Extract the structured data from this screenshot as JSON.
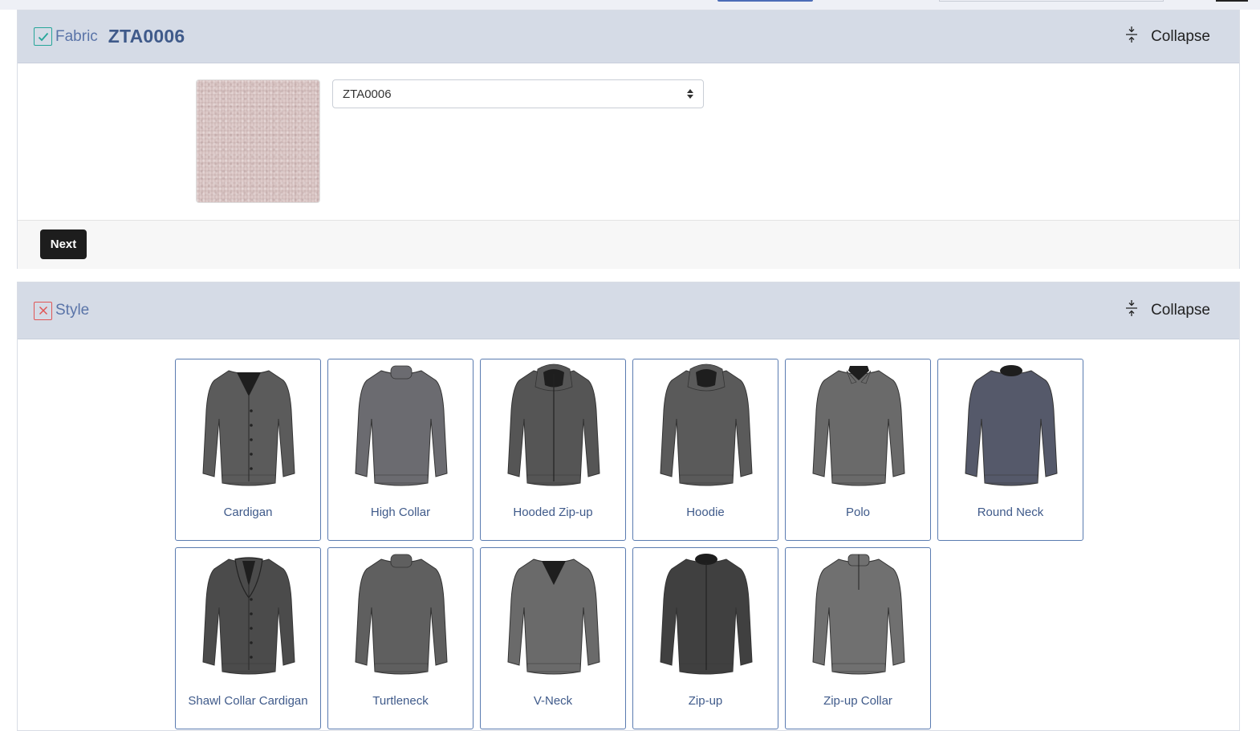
{
  "fabric": {
    "label": "Fabric",
    "value": "ZTA0006",
    "collapse_label": "Collapse",
    "select_value": "ZTA0006",
    "next_label": "Next"
  },
  "style": {
    "label": "Style",
    "collapse_label": "Collapse",
    "items": [
      {
        "label": "Cardigan",
        "icon": "cardigan-icon",
        "color": "#5b5b5b"
      },
      {
        "label": "High Collar",
        "icon": "high-collar-sweater-icon",
        "color": "#6b6b70"
      },
      {
        "label": "Hooded Zip-up",
        "icon": "hooded-zip-up-icon",
        "color": "#555555"
      },
      {
        "label": "Hoodie",
        "icon": "hoodie-icon",
        "color": "#5a5a5a"
      },
      {
        "label": "Polo",
        "icon": "polo-sweater-icon",
        "color": "#6a6a6a"
      },
      {
        "label": "Round Neck",
        "icon": "round-neck-sweater-icon",
        "color": "#55596a"
      },
      {
        "label": "Shawl Collar Cardigan",
        "icon": "shawl-collar-cardigan-icon",
        "color": "#4b4b4b"
      },
      {
        "label": "Turtleneck",
        "icon": "turtleneck-sweater-icon",
        "color": "#5f5f5f"
      },
      {
        "label": "V-Neck",
        "icon": "v-neck-sweater-icon",
        "color": "#6a6a6a"
      },
      {
        "label": "Zip-up",
        "icon": "zip-up-sweater-icon",
        "color": "#404040"
      },
      {
        "label": "Zip-up Collar",
        "icon": "zip-up-collar-sweater-icon",
        "color": "#707070"
      }
    ]
  }
}
